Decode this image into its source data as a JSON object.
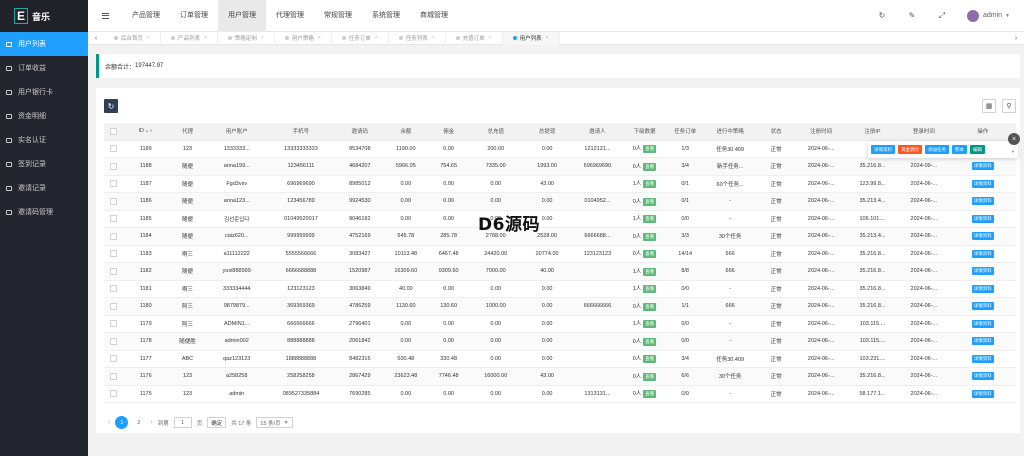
{
  "app": {
    "logo_letter": "E",
    "logo_text": "音乐"
  },
  "sidebar": {
    "items": [
      {
        "label": "用户列表",
        "icon": "users-icon",
        "active": true
      },
      {
        "label": "订单收益",
        "icon": "box-icon"
      },
      {
        "label": "用户银行卡",
        "icon": "card-icon"
      },
      {
        "label": "资金明细",
        "icon": "money-icon"
      },
      {
        "label": "实名认证",
        "icon": "id-icon"
      },
      {
        "label": "签到记录",
        "icon": "calendar-icon"
      },
      {
        "label": "邀请记录",
        "icon": "invite-icon"
      },
      {
        "label": "邀请码管理",
        "icon": "code-icon"
      }
    ]
  },
  "header": {
    "nav": [
      "产品管理",
      "订单管理",
      "用户管理",
      "代理管理",
      "常规管理",
      "系统管理",
      "商城管理"
    ],
    "active_nav": 2,
    "user": "admin"
  },
  "tabs": [
    {
      "label": "后台首页"
    },
    {
      "label": "产品列表"
    },
    {
      "label": "策略定制"
    },
    {
      "label": "用户策略"
    },
    {
      "label": "任务订单"
    },
    {
      "label": "任务列表"
    },
    {
      "label": "充值订单"
    },
    {
      "label": "用户列表",
      "active": true
    }
  ],
  "balance": {
    "label": "余额合计：",
    "value": "197447.97"
  },
  "table": {
    "columns": [
      "ID",
      "代理",
      "用户账户",
      "手机号",
      "邀请码",
      "余额",
      "佣金",
      "总充值",
      "总提现",
      "邀请人",
      "下级数据",
      "任务订单",
      "进行中策略",
      "状态",
      "注册时间",
      "注册IP",
      "登录时间",
      "操作"
    ],
    "view_label": "查看",
    "detail_label": "详情资料",
    "rows": [
      {
        "id": "1189",
        "agent": "123",
        "account": "1333333...",
        "phone": "13333333333",
        "code": "8534708",
        "balance": "1190.00",
        "commission": "0.00",
        "recharge": "200.00",
        "withdraw": "0.00",
        "inviter": "1212121...",
        "sub": "0人",
        "orders": "1/3",
        "strategy": "任务30.409",
        "status": "正常",
        "reg_time": "2024-06-...",
        "reg_ip": "",
        "login_time": ""
      },
      {
        "id": "1188",
        "agent": "随便",
        "account": "anna199...",
        "phone": "123456111",
        "code": "4684207",
        "balance": "5966.05",
        "commission": "754.65",
        "recharge": "7335.00",
        "withdraw": "1993.00",
        "inviter": "696969690",
        "sub": "0人",
        "orders": "3/4",
        "strategy": "新手任务...",
        "status": "正常",
        "reg_time": "2024-06-...",
        "reg_ip": "35.216.8...",
        "login_time": "2024-09-..."
      },
      {
        "id": "1187",
        "agent": "随便",
        "account": "Fgd3vxv",
        "phone": "696969690",
        "code": "8985012",
        "balance": "0.00",
        "commission": "0.00",
        "recharge": "0.00",
        "withdraw": "43.00",
        "inviter": "",
        "sub": "1人",
        "orders": "0/1",
        "strategy": "60个任务...",
        "status": "正常",
        "reg_time": "2024-06-...",
        "reg_ip": "123.99.8...",
        "login_time": "2024-06-..."
      },
      {
        "id": "1186",
        "agent": "随便",
        "account": "anna123...",
        "phone": "123456789",
        "code": "9924530",
        "balance": "0.00",
        "commission": "0.00",
        "recharge": "0.00",
        "withdraw": "0.00",
        "inviter": "0104952...",
        "sub": "0人",
        "orders": "0/1",
        "strategy": "-",
        "status": "正常",
        "reg_time": "2024-06-...",
        "reg_ip": "35.213.4...",
        "login_time": "2024-06-..."
      },
      {
        "id": "1185",
        "agent": "随便",
        "account": "김선준입다",
        "phone": "01049520017",
        "code": "9046192",
        "balance": "0.00",
        "commission": "0.00",
        "recharge": "0.00",
        "withdraw": "0.00",
        "inviter": "",
        "sub": "1人",
        "orders": "0/0",
        "strategy": "-",
        "status": "正常",
        "reg_time": "2024-06-...",
        "reg_ip": "106.101....",
        "login_time": "2024-06-..."
      },
      {
        "id": "1184",
        "agent": "随便",
        "account": "caiz620...",
        "phone": "999999999",
        "code": "4752169",
        "balance": "545.78",
        "commission": "285.78",
        "recharge": "2788.00",
        "withdraw": "2528.00",
        "inviter": "6666688...",
        "sub": "0人",
        "orders": "3/3",
        "strategy": "30个任务",
        "status": "正常",
        "reg_time": "2024-06-...",
        "reg_ip": "35.213.4...",
        "login_time": "2024-06-..."
      },
      {
        "id": "1183",
        "agent": "啊三",
        "account": "a11112222",
        "phone": "5555566666",
        "code": "3083427",
        "balance": "10113.48",
        "commission": "6467.48",
        "recharge": "24420.00",
        "withdraw": "20774.00",
        "inviter": "123123123",
        "sub": "0人",
        "orders": "14/14",
        "strategy": "666",
        "status": "正常",
        "reg_time": "2024-06-...",
        "reg_ip": "35.216.8...",
        "login_time": "2024-06-..."
      },
      {
        "id": "1182",
        "agent": "随便",
        "account": "yuxi888999",
        "phone": "6666688888",
        "code": "1520987",
        "balance": "16309.60",
        "commission": "9309.60",
        "recharge": "7000.00",
        "withdraw": "40.00",
        "inviter": "",
        "sub": "1人",
        "orders": "8/8",
        "strategy": "666",
        "status": "正常",
        "reg_time": "2024-06-...",
        "reg_ip": "35.216.8...",
        "login_time": "2024-06-..."
      },
      {
        "id": "1181",
        "agent": "啊三",
        "account": "333334444",
        "phone": "123123123",
        "code": "3063849",
        "balance": "40.00",
        "commission": "0.00",
        "recharge": "0.00",
        "withdraw": "0.00",
        "inviter": "",
        "sub": "1人",
        "orders": "0/0",
        "strategy": "-",
        "status": "正常",
        "reg_time": "2024-06-...",
        "reg_ip": "35.216.8...",
        "login_time": "2024-06-..."
      },
      {
        "id": "1180",
        "agent": "阿三",
        "account": "9879879...",
        "phone": "369369369",
        "code": "4786259",
        "balance": "1130.60",
        "commission": "130.60",
        "recharge": "1000.00",
        "withdraw": "0.00",
        "inviter": "666666666",
        "sub": "0人",
        "orders": "1/1",
        "strategy": "666",
        "status": "正常",
        "reg_time": "2024-06-...",
        "reg_ip": "35.216.8...",
        "login_time": "2024-06-..."
      },
      {
        "id": "1179",
        "agent": "阿三",
        "account": "ADMIN1...",
        "phone": "666666666",
        "code": "2796401",
        "balance": "0.00",
        "commission": "0.00",
        "recharge": "0.00",
        "withdraw": "0.00",
        "inviter": "",
        "sub": "1人",
        "orders": "0/0",
        "strategy": "-",
        "status": "正常",
        "reg_time": "2024-06-...",
        "reg_ip": "103.115....",
        "login_time": "2024-06-..."
      },
      {
        "id": "1178",
        "agent": "随便胜",
        "account": "admin002",
        "phone": "888888888",
        "code": "2061842",
        "balance": "0.00",
        "commission": "0.00",
        "recharge": "0.00",
        "withdraw": "0.00",
        "inviter": "",
        "sub": "0人",
        "orders": "0/0",
        "strategy": "-",
        "status": "正常",
        "reg_time": "2024-06-...",
        "reg_ip": "103.115....",
        "login_time": "2024-06-..."
      },
      {
        "id": "1177",
        "agent": "ABC",
        "account": "qaz123123",
        "phone": "1888888888",
        "code": "8482316",
        "balance": "500.48",
        "commission": "330.48",
        "recharge": "0.00",
        "withdraw": "0.00",
        "inviter": "",
        "sub": "0人",
        "orders": "3/4",
        "strategy": "任务30.409",
        "status": "正常",
        "reg_time": "2024-06-...",
        "reg_ip": "103.231....",
        "login_time": "2024-06-..."
      },
      {
        "id": "1176",
        "agent": "123",
        "account": "a258258",
        "phone": "258258258",
        "code": "2867429",
        "balance": "23623.48",
        "commission": "7746.48",
        "recharge": "16000.00",
        "withdraw": "43.00",
        "inviter": "",
        "sub": "0人",
        "orders": "6/6",
        "strategy": "30个任务",
        "status": "正常",
        "reg_time": "2024-06-...",
        "reg_ip": "35.216.8...",
        "login_time": "2024-06-..."
      },
      {
        "id": "1175",
        "agent": "123",
        "account": "admin",
        "phone": "089527335884",
        "code": "7690285",
        "balance": "0.00",
        "commission": "0.00",
        "recharge": "0.00",
        "withdraw": "0.00",
        "inviter": "1313131...",
        "sub": "0人",
        "orders": "0/0",
        "strategy": "-",
        "status": "正常",
        "reg_time": "2024-06-...",
        "reg_ip": "58.177.1...",
        "login_time": "2024-06-..."
      }
    ]
  },
  "popover": {
    "buttons": [
      {
        "label": "详情资料",
        "color": "#1e9fff"
      },
      {
        "label": "资金调控",
        "color": "#ff5722"
      },
      {
        "label": "添加任务",
        "color": "#1e9fff"
      },
      {
        "label": "熊本",
        "color": "#1e9fff"
      },
      {
        "label": "编辑",
        "color": "#009688"
      }
    ]
  },
  "pager": {
    "pages": [
      "1",
      "2"
    ],
    "current": "1",
    "goto_label": "到第",
    "goto_value": "1",
    "page_unit": "页",
    "confirm": "确定",
    "total": "共 17 条",
    "per_page": "15 条/页"
  },
  "watermark": "D6源码"
}
